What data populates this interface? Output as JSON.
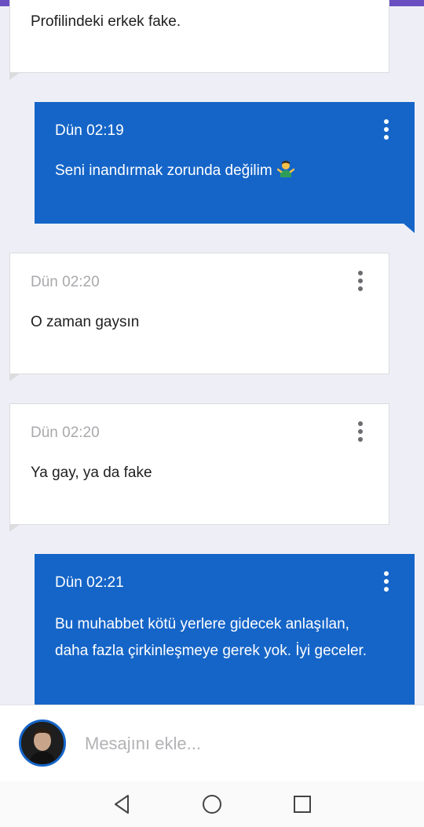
{
  "messages": [
    {
      "direction": "in",
      "time": "",
      "text": "Profilindeki erkek fake."
    },
    {
      "direction": "out",
      "time": "Dün 02:19",
      "text": "Seni inandırmak zorunda değilim",
      "emoji": "person-shrugging-emoji"
    },
    {
      "direction": "in",
      "time": "Dün 02:20",
      "text": "O zaman gaysın"
    },
    {
      "direction": "in",
      "time": "Dün 02:20",
      "text": "Ya gay, ya da fake"
    },
    {
      "direction": "out",
      "time": "Dün 02:21",
      "text": "Bu muhabbet kötü yerlere gidecek anlaşılan, daha fazla çirkinleşmeye gerek yok. İyi geceler."
    }
  ],
  "composer": {
    "placeholder": "Mesajını ekle...",
    "avatar_icon": "user-avatar"
  },
  "navbar": {
    "back_icon": "back-triangle-icon",
    "home_icon": "home-circle-icon",
    "recents_icon": "recents-square-icon"
  },
  "colors": {
    "accent_top": "#6a4fc2",
    "outgoing_bubble": "#1565c8",
    "incoming_bubble": "#ffffff",
    "background": "#eeeff6"
  }
}
